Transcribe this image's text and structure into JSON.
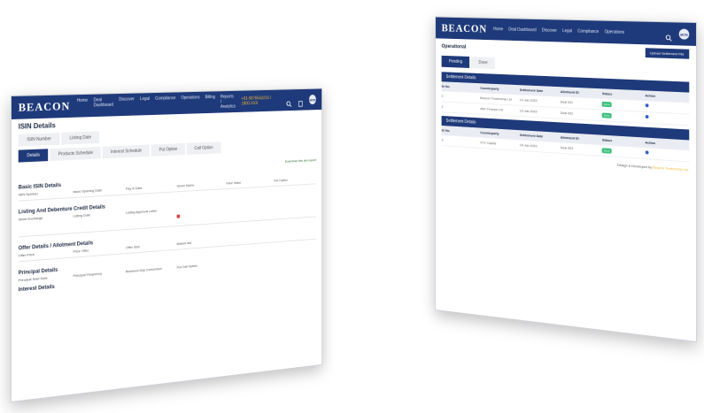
{
  "left": {
    "brand": "BEACON",
    "nav": [
      "Home",
      "Deal Dashboard",
      "Discover",
      "Legal",
      "Compliance",
      "Operations",
      "Billing",
      "Reports / Analytics"
    ],
    "phone": "+91-9876543210 / 1800-XXX",
    "avatar": "BCN",
    "title": "ISIN Details",
    "subtabs": [
      "ISIN Number",
      "Listing Date"
    ],
    "tabs": [
      "Details",
      "Products Schedule",
      "Interest Schedule",
      "Put Option",
      "Call Option"
    ],
    "download": "Download this isin report",
    "sections": [
      {
        "title": "Basic ISIN Details",
        "pairs": [
          [
            "ISIN Number",
            ""
          ],
          [
            "Issue Opening Date",
            ""
          ],
          [
            "Pay in Date",
            ""
          ],
          [
            "Issuer Name",
            ""
          ],
          [
            "Face Value",
            ""
          ],
          [
            "Put Option",
            ""
          ]
        ]
      },
      {
        "title": "Listing And Debenture Credit Details",
        "pairs": [
          [
            "Stock Exchange",
            ""
          ],
          [
            "Listing Date",
            ""
          ],
          [
            "Listing Approval Letter",
            ""
          ]
        ]
      },
      {
        "title": "Offer Details / Allotment Details",
        "pairs": [
          [
            "Offer Price",
            ""
          ],
          [
            "Price Offer",
            ""
          ],
          [
            "Offer Size",
            ""
          ],
          [
            "Market Bid",
            ""
          ]
        ]
      },
      {
        "title": "Principal Details",
        "pairs": [
          [
            "Principal Start Date",
            ""
          ],
          [
            "Principal Frequency",
            ""
          ],
          [
            "Business Day Convention",
            ""
          ],
          [
            "Put Call Option",
            ""
          ]
        ]
      },
      {
        "title": "Interest Details",
        "pairs": []
      }
    ]
  },
  "right": {
    "brand": "BEACON",
    "nav": [
      "Home",
      "Deal Dashboard",
      "Discover",
      "Legal",
      "Compliance",
      "Operations",
      "Billing",
      "Reports / Analytics"
    ],
    "phone": "+91-9876543210 / 1800-XXX",
    "avatar": "BCN",
    "subtitle": "Operational",
    "button": "Upload Settlement File",
    "toggle": [
      "Pending",
      "Done"
    ],
    "panel1": "Settlement Details",
    "panel2": "Settlement Details",
    "headers": [
      "Sr No.",
      "Counterparty",
      "Settlement Date",
      "Allotment ID",
      "Status",
      "Action"
    ],
    "rows": [
      [
        "1",
        "Beacon Trusteeship Ltd",
        "12-Jan-2023",
        "Deal 001",
        "Done",
        ""
      ],
      [
        "2",
        "ABC Finance Ltd",
        "15-Jan-2023",
        "Deal 002",
        "Done",
        ""
      ],
      [
        "3",
        "XYZ Capital",
        "18-Jan-2023",
        "Deal 003",
        "Done",
        ""
      ]
    ],
    "credit": "Design & Developed by",
    "credit_brand": "Beacon Trusteeship Ltd."
  }
}
